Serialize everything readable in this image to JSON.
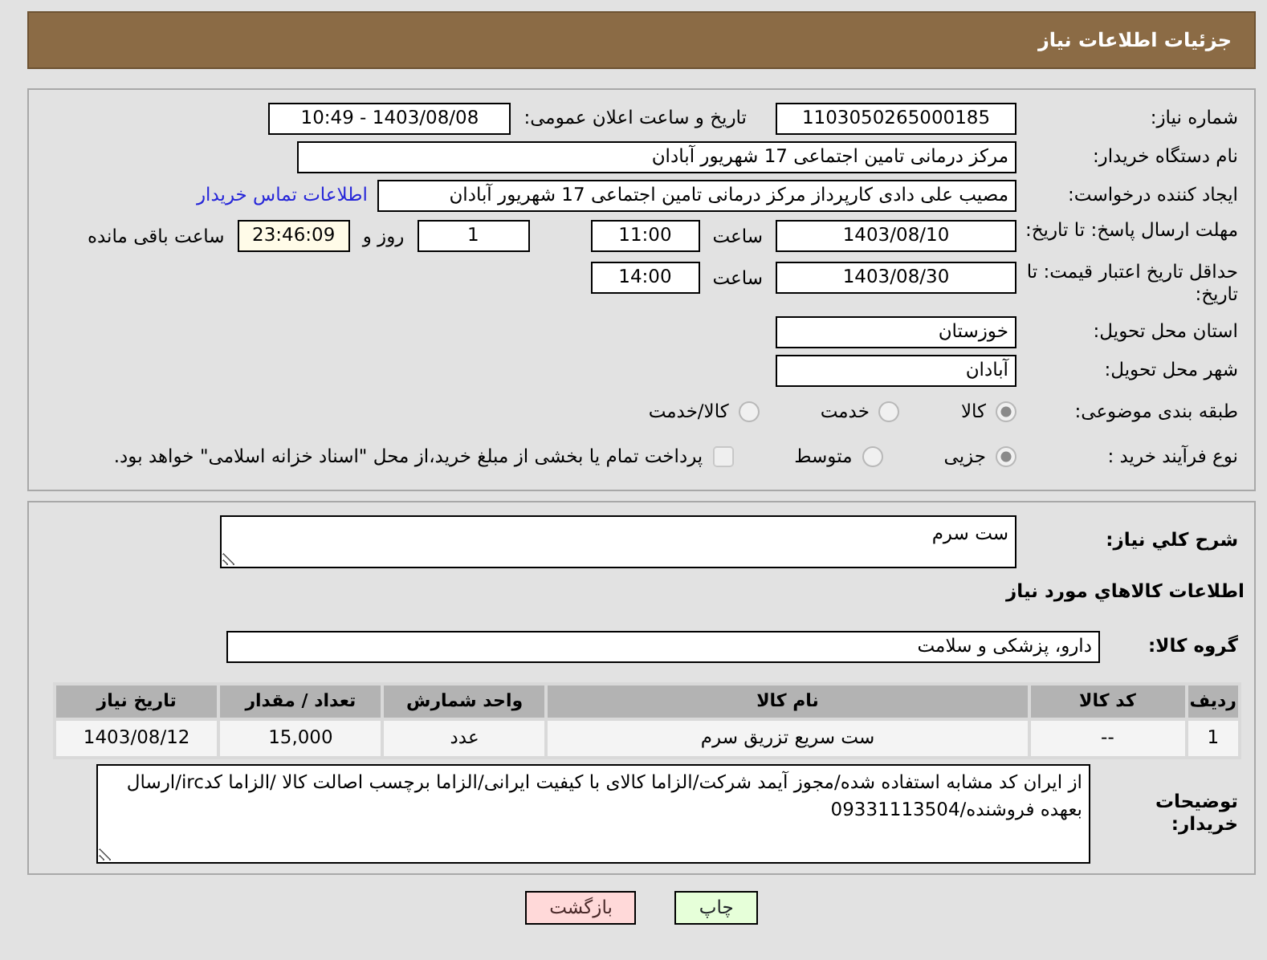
{
  "header": {
    "title": "جزئیات اطلاعات نیاز"
  },
  "details": {
    "need_number": {
      "label": "شماره نیاز:",
      "value": "1103050265000185"
    },
    "announce": {
      "label": "تاریخ و ساعت اعلان عمومی:",
      "value": "1403/08/08 - 10:49"
    },
    "buyer_org": {
      "label": "نام دستگاه خریدار:",
      "value": "مرکز درمانی تامین اجتماعی 17 شهریور آبادان"
    },
    "creator": {
      "label": "ایجاد کننده درخواست:",
      "value": "مصیب علی دادی کارپرداز مرکز درمانی تامین اجتماعی 17 شهریور آبادان",
      "link": "اطلاعات تماس خریدار"
    },
    "deadline": {
      "label": "مهلت ارسال پاسخ: تا تاریخ:",
      "date": "1403/08/10",
      "time_label": "ساعت",
      "time": "11:00",
      "days": "1",
      "days_label": "روز و",
      "remaining": "23:46:09",
      "remaining_label": "ساعت باقی مانده"
    },
    "validity": {
      "label": "حداقل تاریخ اعتبار قیمت: تا تاریخ:",
      "date": "1403/08/30",
      "time_label": "ساعت",
      "time": "14:00"
    },
    "province": {
      "label": "استان محل تحویل:",
      "value": "خوزستان"
    },
    "city": {
      "label": "شهر محل تحویل:",
      "value": "آبادان"
    },
    "category": {
      "label": "طبقه بندی موضوعی:",
      "options": [
        {
          "label": "کالا",
          "selected": true
        },
        {
          "label": "خدمت",
          "selected": false
        },
        {
          "label": "کالا/خدمت",
          "selected": false
        }
      ]
    },
    "process": {
      "label": "نوع فرآیند خرید :",
      "options": [
        {
          "label": "جزیی",
          "selected": true
        },
        {
          "label": "متوسط",
          "selected": false
        }
      ],
      "payment": {
        "checked": false,
        "text": "پرداخت تمام یا بخشی از مبلغ خرید،از محل \"اسناد خزانه اسلامی\" خواهد بود."
      }
    }
  },
  "summary": {
    "label": "شرح كلي نياز:",
    "value": "ست سرم"
  },
  "items_heading": "اطلاعات كالاهاي مورد نياز",
  "goods_group": {
    "label": "گروه کالا:",
    "value": "دارو، پزشکی و سلامت"
  },
  "table": {
    "columns": [
      "ردیف",
      "کد کالا",
      "نام کالا",
      "واحد شمارش",
      "تعداد / مقدار",
      "تاریخ نیاز"
    ],
    "rows": [
      [
        "1",
        "--",
        "ست سریع تزریق سرم",
        "عدد",
        "15,000",
        "1403/08/12"
      ]
    ]
  },
  "buyer_notes": {
    "label": "توضیحات خریدار:",
    "value": "از ایران کد مشابه استفاده شده/مجوز آیمد شرکت/الزاما کالای با کیفیت ایرانی/الزاما برچسب اصالت کالا /الزاما کدirc/ارسال بعهده فروشنده/09331113504"
  },
  "buttons": [
    {
      "label": "چاپ",
      "kind": "print"
    },
    {
      "label": "بازگشت",
      "kind": "back"
    }
  ]
}
